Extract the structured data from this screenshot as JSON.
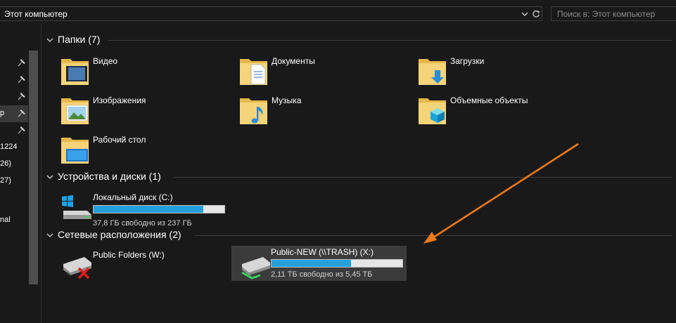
{
  "address_bar": {
    "path": "Этот компьютер"
  },
  "search": {
    "placeholder": "Поиск в: Этот компьютер"
  },
  "nav": {
    "items": [
      {
        "label": "",
        "pinned": true
      },
      {
        "label": "",
        "pinned": true
      },
      {
        "label": "",
        "pinned": true
      },
      {
        "label": "р",
        "pinned": true,
        "selected": true
      },
      {
        "label": "",
        "pinned": true
      },
      {
        "label": "1224",
        "pinned": false
      },
      {
        "label": "26)",
        "pinned": false
      },
      {
        "label": "27)",
        "pinned": false
      },
      {
        "label": "nal",
        "pinned": false
      }
    ]
  },
  "groups": {
    "folders": {
      "title": "Папки (7)",
      "items": [
        {
          "label": "Видео",
          "icon": "video-folder-icon"
        },
        {
          "label": "Документы",
          "icon": "documents-folder-icon"
        },
        {
          "label": "Загрузки",
          "icon": "downloads-folder-icon"
        },
        {
          "label": "Изображения",
          "icon": "pictures-folder-icon"
        },
        {
          "label": "Музыка",
          "icon": "music-folder-icon"
        },
        {
          "label": "Объемные объекты",
          "icon": "3d-objects-folder-icon"
        },
        {
          "label": "Рабочий стол",
          "icon": "desktop-folder-icon"
        }
      ]
    },
    "devices": {
      "title": "Устройства и диски (1)",
      "items": [
        {
          "label": "Локальный диск (C:)",
          "free": "37,8 ГБ свободно из 237 ГБ",
          "used_fraction": 0.84
        }
      ]
    },
    "network": {
      "title": "Сетевые расположения (2)",
      "items": [
        {
          "label": "Public Folders (W:)",
          "disconnected": true
        },
        {
          "label": "Public-NEW (\\\\TRASH) (X:)",
          "free": "2,11 ТБ свободно из 5,45 ТБ",
          "used_fraction": 0.61,
          "selected": true
        }
      ]
    }
  },
  "colors": {
    "accent": "#26a0da",
    "annotation_arrow": "#f07a1a",
    "background": "#191919"
  }
}
